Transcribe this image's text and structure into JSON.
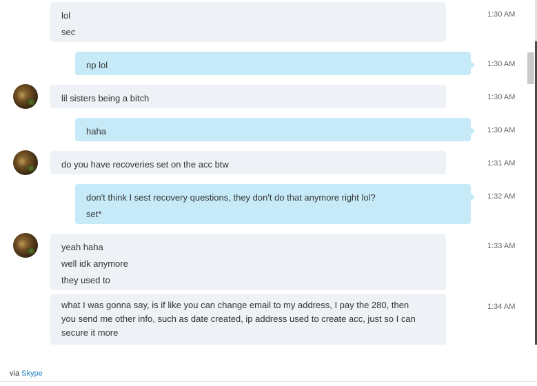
{
  "messages": [
    {
      "direction": "in",
      "lines": [
        "lol",
        "sec"
      ],
      "time": "1:30 AM"
    },
    {
      "direction": "out",
      "lines": [
        "np lol"
      ],
      "time": "1:30 AM"
    },
    {
      "direction": "in",
      "lines": [
        "lil sisters being a bitch"
      ],
      "time": "1:30 AM"
    },
    {
      "direction": "out",
      "lines": [
        "haha"
      ],
      "time": "1:30 AM"
    },
    {
      "direction": "in",
      "lines": [
        "do you have recoveries set on the acc btw"
      ],
      "time": "1:31 AM"
    },
    {
      "direction": "out",
      "lines": [
        "don't think I sest recovery questions, they don't do that anymore right lol?",
        "set*"
      ],
      "time": "1:32 AM"
    },
    {
      "direction": "in",
      "lines": [
        "yeah haha",
        "well idk anymore",
        "they used to"
      ],
      "time": "1:33 AM"
    },
    {
      "direction": "in",
      "lines": [
        "what I was gonna say, is if like you can change email to my address, I pay the 280, then",
        "you send me other info, such as date created, ip address used to create acc, just so I can",
        "secure it more"
      ],
      "time": "1:34 AM"
    }
  ],
  "footer": {
    "prefix": "via",
    "link": "Skype"
  }
}
